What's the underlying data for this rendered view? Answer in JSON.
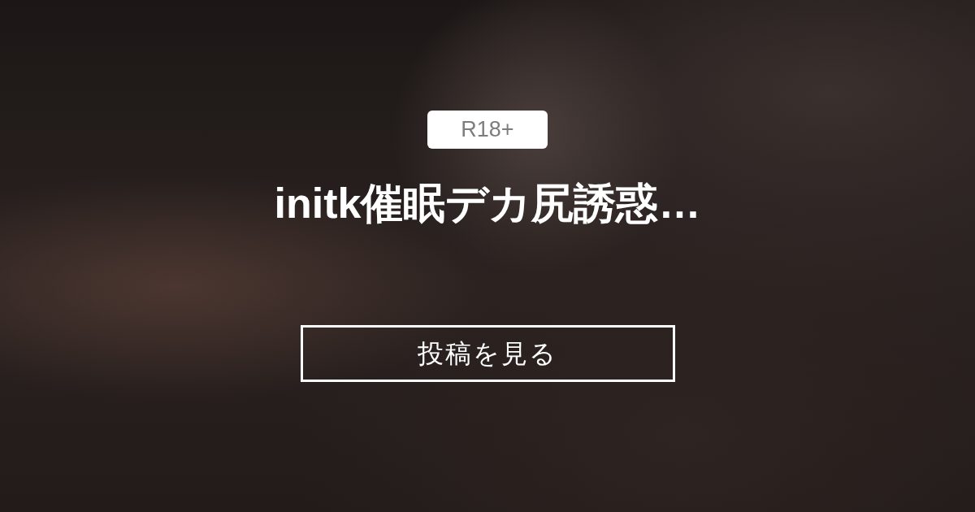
{
  "badge": {
    "label": "R18+"
  },
  "title": "initk催眠デカ尻誘惑…",
  "button": {
    "label": "投稿を見る"
  }
}
